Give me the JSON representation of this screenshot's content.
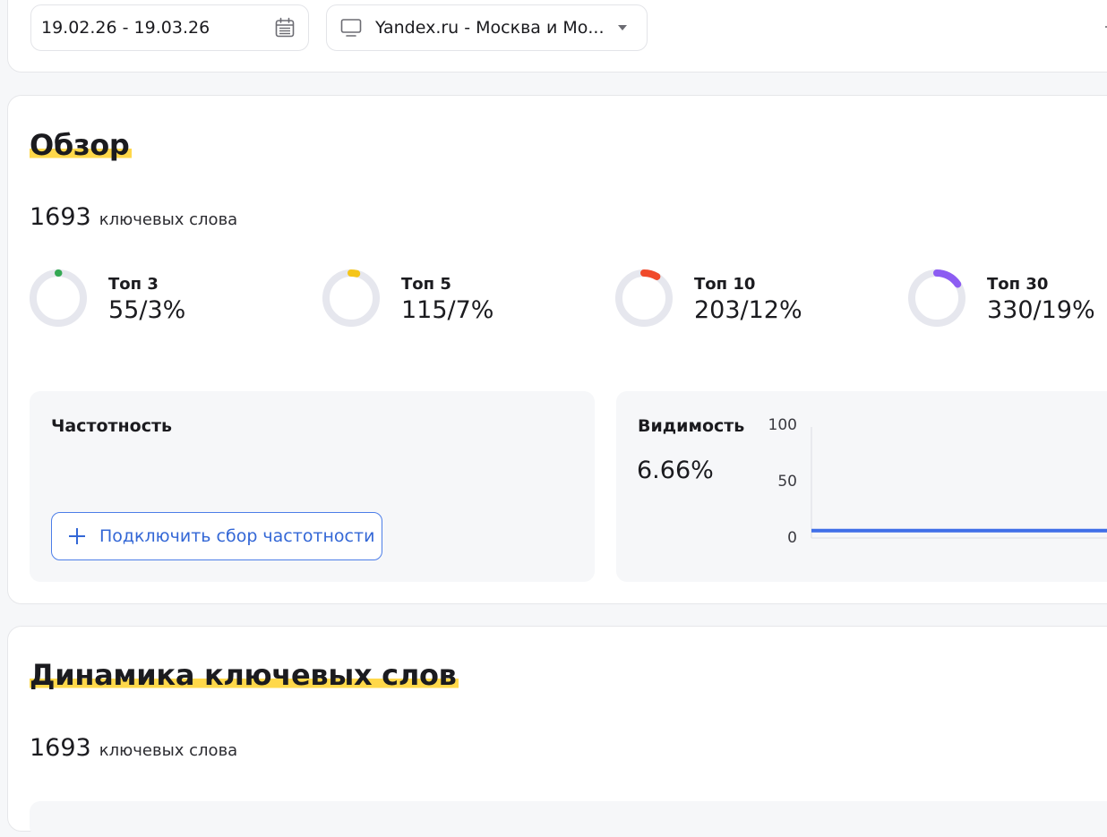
{
  "filters": {
    "date_range": "19.02.26 - 19.03.26",
    "region": "Yandex.ru - Москва и Мо..."
  },
  "overview": {
    "title": "Обзор",
    "keywords_count": "1693",
    "keywords_label": "ключевых слова",
    "tops": [
      {
        "label": "Топ 3",
        "value": "55/3%",
        "fraction": 0.03,
        "color": "#34a853"
      },
      {
        "label": "Топ 5",
        "value": "115/7%",
        "fraction": 0.07,
        "color": "#f5c518"
      },
      {
        "label": "Топ 10",
        "value": "203/12%",
        "fraction": 0.12,
        "color": "#f04a2b"
      },
      {
        "label": "Топ 30",
        "value": "330/19%",
        "fraction": 0.19,
        "color": "#8c5cf2"
      }
    ],
    "ring_track_color": "#e6e7ee",
    "frequency": {
      "title": "Частотность",
      "connect_button": "Подключить сбор частотности"
    },
    "visibility": {
      "title": "Видимость",
      "value": "6.66%",
      "chart_data": {
        "type": "line",
        "y_ticks": [
          "100",
          "50",
          "0"
        ],
        "ylim": [
          0,
          100
        ],
        "series": [
          {
            "values": [
              6.66,
              6.66
            ]
          }
        ],
        "color": "#3f6ee8"
      }
    }
  },
  "dynamics": {
    "title": "Динамика ключевых слов",
    "keywords_count": "1693",
    "keywords_label": "ключевых слова"
  },
  "colors": {
    "accent": "#3367d6",
    "highlight": "#ffd84a"
  }
}
